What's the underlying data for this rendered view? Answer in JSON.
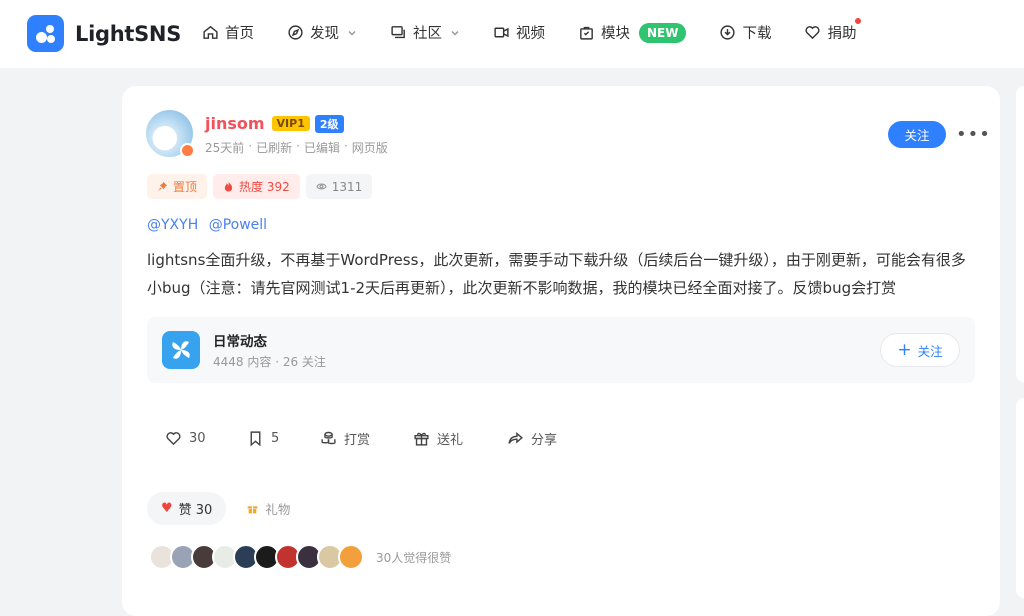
{
  "brand": {
    "name": "LightSNS",
    "accent": "#2f80ff"
  },
  "nav": {
    "items": [
      {
        "label": "首页",
        "icon": "home-icon"
      },
      {
        "label": "发现",
        "icon": "compass-icon",
        "dropdown": true
      },
      {
        "label": "社区",
        "icon": "chat-icon",
        "dropdown": true
      },
      {
        "label": "视频",
        "icon": "video-icon"
      },
      {
        "label": "模块",
        "icon": "bag-icon",
        "badge": "NEW"
      },
      {
        "label": "下载",
        "icon": "download-icon"
      },
      {
        "label": "捐助",
        "icon": "heart-icon",
        "dot": true
      }
    ]
  },
  "post": {
    "author": "jinsom",
    "vip": "VIP1",
    "level": "2级",
    "meta": [
      "25天前",
      "已刷新",
      "已编辑",
      "网页版"
    ],
    "follow_label": "关注",
    "tags": {
      "top": "置顶",
      "hot": "热度 392",
      "views": "1311"
    },
    "mentions": [
      "@YXYH",
      "@Powell"
    ],
    "content": "lightsns全面升级，不再基于WordPress，此次更新，需要手动下载升级（后续后台一键升级），由于刚更新，可能会有很多小bug（注意：请先官网测试1-2天后再更新），此次更新不影响数据，我的模块已经全面对接了。反馈bug会打赏",
    "topic": {
      "name": "日常动态",
      "posts": "4448 内容",
      "followers": "26 关注",
      "follow_label": "关注"
    },
    "actions": {
      "like": "30",
      "bookmark": "5",
      "reward": "打赏",
      "gift": "送礼",
      "share": "分享"
    },
    "like_pill": "赞 30",
    "gift_link": "礼物",
    "voters_text": "30人觉得很赞",
    "voter_colors": [
      "#e9e3dc",
      "#9aa3b5",
      "#4a3b3b",
      "#e8ece6",
      "#2c3e56",
      "#1b1b1b",
      "#c2332f",
      "#3a3040",
      "#d9c8a2",
      "#f3a03c"
    ]
  }
}
